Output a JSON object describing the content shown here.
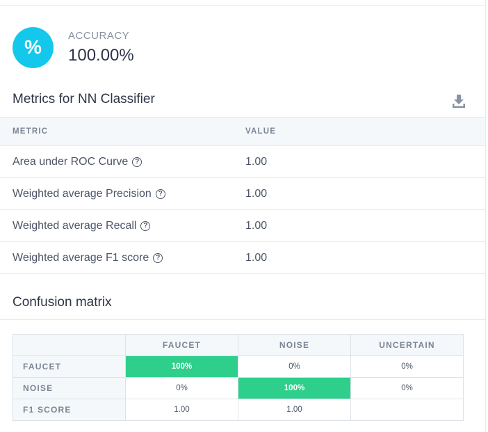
{
  "accuracy": {
    "icon": "percent-icon",
    "icon_glyph": "%",
    "label": "ACCURACY",
    "value": "100.00%",
    "color": "#14c8ec"
  },
  "metrics": {
    "title": "Metrics for NN Classifier",
    "download_icon": "download-icon",
    "columns": [
      "METRIC",
      "VALUE"
    ],
    "rows": [
      {
        "metric": "Area under ROC Curve",
        "value": "1.00"
      },
      {
        "metric": "Weighted average Precision",
        "value": "1.00"
      },
      {
        "metric": "Weighted average Recall",
        "value": "1.00"
      },
      {
        "metric": "Weighted average F1 score",
        "value": "1.00"
      }
    ],
    "help_glyph": "?"
  },
  "confusion_matrix": {
    "title": "Confusion matrix",
    "columns": [
      "FAUCET",
      "NOISE",
      "UNCERTAIN"
    ],
    "rows": [
      {
        "label": "FAUCET",
        "cells": [
          "100%",
          "0%",
          "0%"
        ]
      },
      {
        "label": "NOISE",
        "cells": [
          "0%",
          "100%",
          "0%"
        ]
      },
      {
        "label": "F1 SCORE",
        "cells": [
          "1.00",
          "1.00",
          ""
        ]
      }
    ],
    "highlight_color": "#2ecf8b"
  }
}
